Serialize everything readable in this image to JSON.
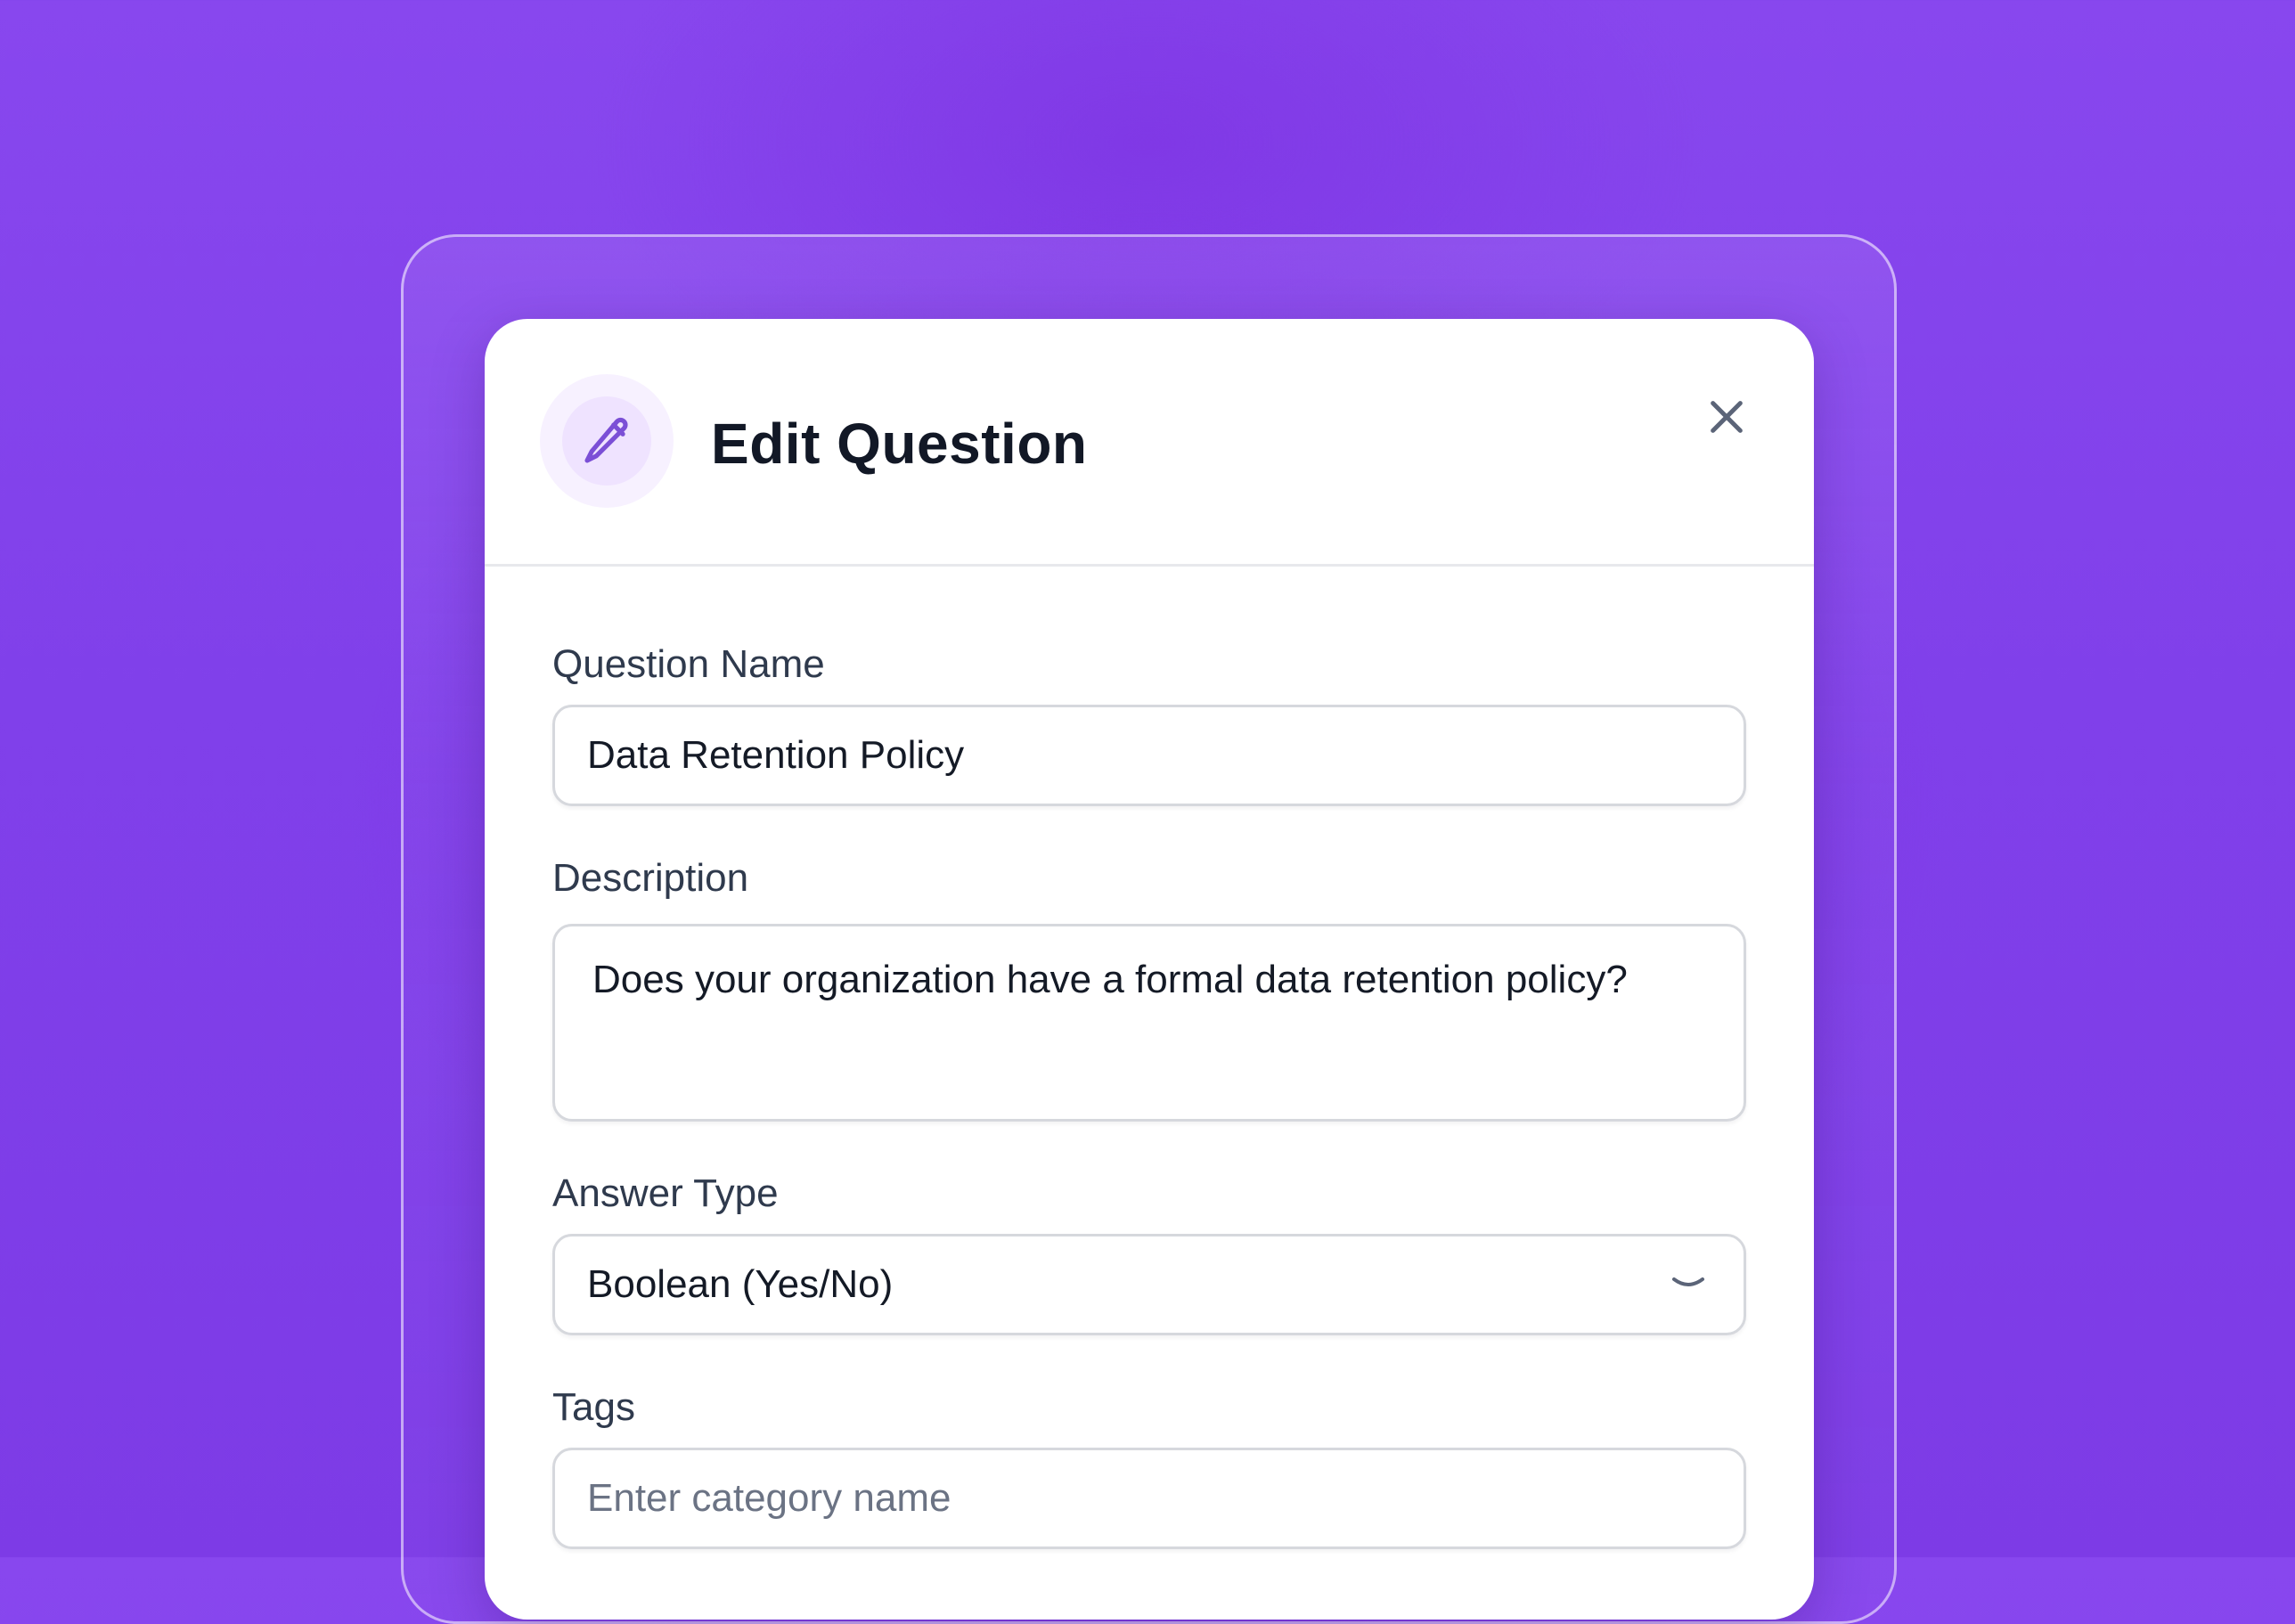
{
  "modal": {
    "title": "Edit Question",
    "header_icon": "pencil-icon",
    "close_icon": "close-icon"
  },
  "form": {
    "question_name": {
      "label": "Question Name",
      "value": "Data Retention Policy"
    },
    "description": {
      "label": "Description",
      "value": "Does your organization have a formal data retention policy?"
    },
    "answer_type": {
      "label": "Answer Type",
      "selected": "Boolean (Yes/No)",
      "icon": "chevron-down-icon"
    },
    "tags": {
      "label": "Tags",
      "placeholder": "Enter category name"
    }
  },
  "colors": {
    "background": "#7d3be6",
    "accent": "#7b4fd6",
    "icon_circle": "#efe3ff",
    "text": "#121826"
  }
}
